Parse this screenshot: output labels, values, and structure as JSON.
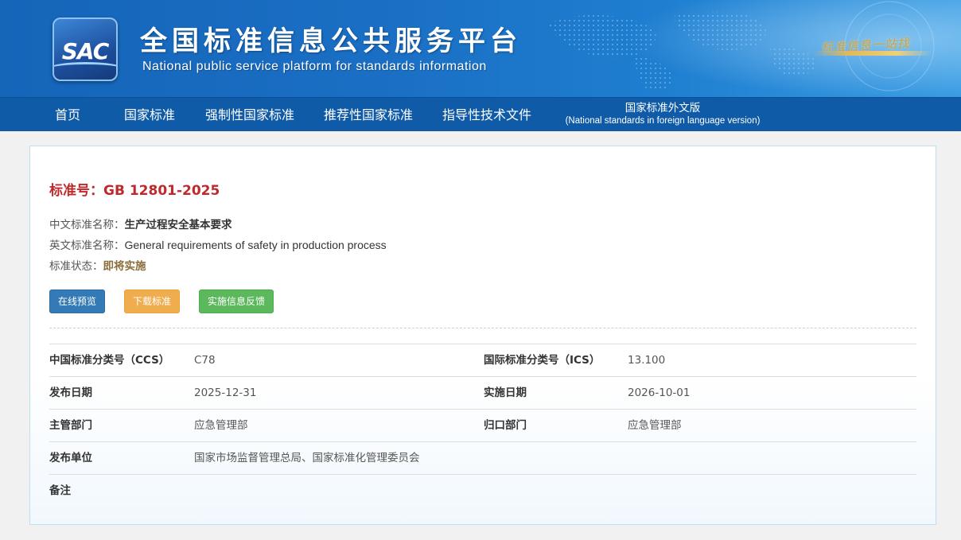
{
  "header": {
    "logo_text": "SAC",
    "title_cn": "全国标准信息公共服务平台",
    "title_en": "National public service platform  for standards information",
    "slogan": "标准信息一站找"
  },
  "nav": {
    "items": [
      {
        "label": "首页"
      },
      {
        "label": "国家标准"
      },
      {
        "label": "强制性国家标准"
      },
      {
        "label": "推荐性国家标准"
      },
      {
        "label": "指导性技术文件"
      }
    ],
    "foreign": {
      "line1": "国家标准外文版",
      "line2": "(National standards in foreign language version)"
    }
  },
  "standard": {
    "number_label": "标准号：",
    "number": "GB 12801-2025",
    "cn_name_label": "中文标准名称：",
    "cn_name": "生产过程安全基本要求",
    "en_name_label": "英文标准名称：",
    "en_name": "General requirements of safety in production process",
    "status_label": "标准状态：",
    "status": "即将实施"
  },
  "buttons": {
    "preview": "在线预览",
    "download": "下载标准",
    "feedback": "实施信息反馈"
  },
  "details": [
    {
      "k1": "中国标准分类号（CCS）",
      "v1": "C78",
      "k2": "国际标准分类号（ICS）",
      "v2": "13.100"
    },
    {
      "k1": "发布日期",
      "v1": "2025-12-31",
      "k2": "实施日期",
      "v2": "2026-10-01"
    },
    {
      "k1": "主管部门",
      "v1": "应急管理部",
      "k2": "归口部门",
      "v2": "应急管理部"
    },
    {
      "k1": "发布单位",
      "v1": "国家市场监督管理总局、国家标准化管理委员会",
      "k2": "",
      "v2": ""
    },
    {
      "k1": "备注",
      "v1": "",
      "k2": "",
      "v2": ""
    }
  ],
  "colors": {
    "banner": "#1a6fc4",
    "nav": "#0f5ba8",
    "std_number": "#c0292c",
    "status": "#8a6d3b",
    "btn_blue": "#337ab7",
    "btn_orange": "#f0ad4e",
    "btn_green": "#5cb85c"
  }
}
